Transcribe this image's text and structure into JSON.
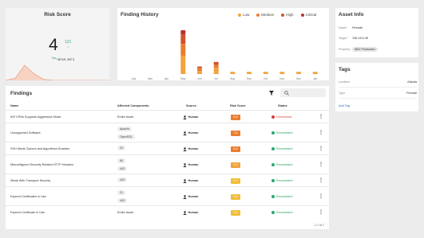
{
  "risk_score": {
    "title": "Risk Score",
    "value": "4",
    "delta_value": "121",
    "delta_arrow": "↓",
    "since": "since Jul 1",
    "spark": [
      0,
      2,
      14,
      6,
      1,
      0,
      0
    ]
  },
  "history": {
    "title": "Finding History",
    "legend": [
      {
        "label": "Low",
        "color": "#f2a33a"
      },
      {
        "label": "Medium",
        "color": "#ea7d30"
      },
      {
        "label": "High",
        "color": "#d2542c"
      },
      {
        "label": "Critical",
        "color": "#b8322a"
      }
    ],
    "chart_data": {
      "type": "bar",
      "stacked": true,
      "categories": [
        "July",
        "Mar",
        "Apr",
        "May",
        "Jun",
        "Jul",
        "Aug",
        "Sep",
        "Oct",
        "Nov",
        "Dec",
        "Jan"
      ],
      "series": [
        {
          "name": "Low",
          "values": [
            0,
            0,
            0,
            6,
            1,
            2,
            0.7,
            0.7,
            0.7,
            0.7,
            0.7,
            0.7
          ]
        },
        {
          "name": "Medium",
          "values": [
            0,
            0,
            0,
            4,
            1,
            1,
            0,
            0,
            0,
            0,
            0,
            0
          ]
        },
        {
          "name": "High",
          "values": [
            0,
            0,
            0,
            3,
            0.5,
            1,
            0,
            0,
            0,
            0,
            0,
            0
          ]
        },
        {
          "name": "Critical",
          "values": [
            0,
            0,
            0,
            1.5,
            0,
            0,
            0,
            0,
            0,
            0,
            0,
            0
          ]
        }
      ]
    }
  },
  "asset_info": {
    "title": "Asset Info",
    "rows": [
      {
        "key": "Name",
        "value": "Firewall"
      },
      {
        "key": "Target",
        "value": "198.18.5.45"
      },
      {
        "key": "Property",
        "value": "ABC Production"
      }
    ]
  },
  "tags": {
    "title": "Tags",
    "rows": [
      {
        "key": "Location",
        "value": "Atlanta"
      },
      {
        "key": "Type",
        "value": "Firewall"
      }
    ],
    "add_label": "Add Tag"
  },
  "findings": {
    "title": "Findings",
    "search_placeholder": "",
    "columns": {
      "name": "Name",
      "components": "Affected Components",
      "source": "Source",
      "score": "Risk Score",
      "status": "Status"
    },
    "rows": [
      {
        "name": "IKE VPNs Supports Aggressive Mode",
        "components": [
          "Entire Asset"
        ],
        "source": "Human",
        "score": "8.5",
        "score_color": "#ea7d30",
        "status": "Unresolved",
        "status_color": "#d2403a"
      },
      {
        "name": "Unsupported Software",
        "components": [
          "Apache",
          "OpenSSL"
        ],
        "source": "Human",
        "score": "7.6",
        "score_color": "#ea7d30",
        "status": "Remediated",
        "status_color": "#2ea56d"
      },
      {
        "name": "SSH Weak Ciphers and Algorithms Enabled",
        "components": [
          "22"
        ],
        "source": "Human",
        "score": "8.5",
        "score_color": "#ea7d30",
        "status": "Remediated",
        "status_color": "#2ea56d"
      },
      {
        "name": "Misconfigured Security-Related HTTP Headers",
        "components": [
          "80",
          "443"
        ],
        "source": "Human",
        "score": "5.2",
        "score_color": "#f2a33a",
        "status": "Remediated",
        "status_color": "#2ea56d"
      },
      {
        "name": "Weak Web Transport Security",
        "components": [
          "443"
        ],
        "source": "Human",
        "score": "4.7",
        "score_color": "#f2bd3a",
        "status": "Remediated",
        "status_color": "#2ea56d"
      },
      {
        "name": "Expired Certificates in Use",
        "components": [
          "21",
          "443"
        ],
        "source": "Human",
        "score": "3.6",
        "score_color": "#f2bd3a",
        "status": "Remediated",
        "status_color": "#2ea56d"
      },
      {
        "name": "Expired Certificate in Use",
        "components": [
          "Entire Asset"
        ],
        "source": "Human",
        "score": "3.4",
        "score_color": "#f2bd3a",
        "status": "Remediated",
        "status_color": "#2ea56d"
      }
    ],
    "pager": "1-7 of 7"
  }
}
